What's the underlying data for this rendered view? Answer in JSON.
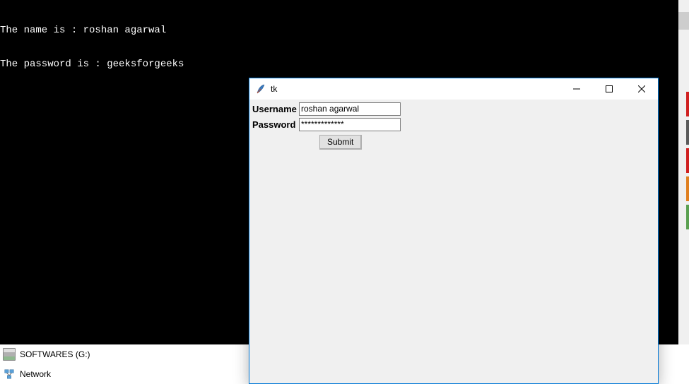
{
  "terminal": {
    "line1": "The name is : roshan agarwal",
    "line2": "The password is : geeksforgeeks"
  },
  "desktop": {
    "item1_label": "SOFTWARES (G:)",
    "item2_label": "Network"
  },
  "tk_window": {
    "title": "tk",
    "username_label": "Username",
    "username_value": "roshan agarwal",
    "password_label": "Password",
    "password_value": "*************",
    "submit_label": "Submit"
  }
}
